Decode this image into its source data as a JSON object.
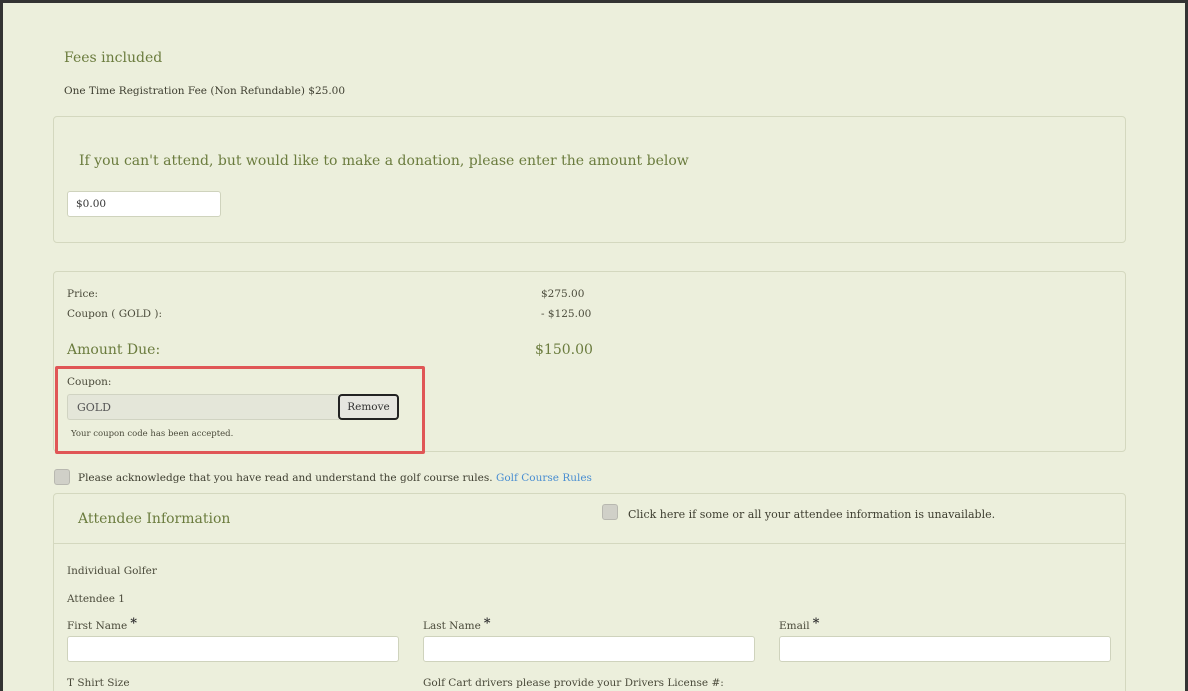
{
  "fees": {
    "title": "Fees included",
    "registration_line": "One Time Registration Fee (Non Refundable) $25.00"
  },
  "donation": {
    "prompt": "If you can't attend, but would like to make a donation, please enter the amount below",
    "value": "$0.00"
  },
  "pricing": {
    "price_label": "Price:",
    "price_value": "$275.00",
    "coupon_line_label": "Coupon ( GOLD ):",
    "coupon_line_value": "- $125.00",
    "amount_due_label": "Amount Due:",
    "amount_due_value": "$150.00"
  },
  "coupon": {
    "label": "Coupon:",
    "value": "GOLD",
    "remove_label": "Remove",
    "message": "Your coupon code has been accepted."
  },
  "acknowledge": {
    "text": "Please acknowledge that you have read and understand the golf course rules.",
    "link_text": "Golf Course Rules"
  },
  "attendee": {
    "title": "Attendee Information",
    "unavailable_text": "Click here if some or all your attendee information is unavailable.",
    "type": "Individual Golfer",
    "attendee_label": "Attendee 1",
    "first_name_label": "First Name",
    "last_name_label": "Last Name",
    "email_label": "Email",
    "required_mark": "*",
    "tshirt_label": "T Shirt Size",
    "license_label": "Golf Cart drivers please provide your Drivers License #:"
  },
  "colors": {
    "background": "#ecefdc",
    "heading_green": "#6b7c3e",
    "link_blue": "#4a8ed1",
    "highlight_red": "#e05656"
  }
}
